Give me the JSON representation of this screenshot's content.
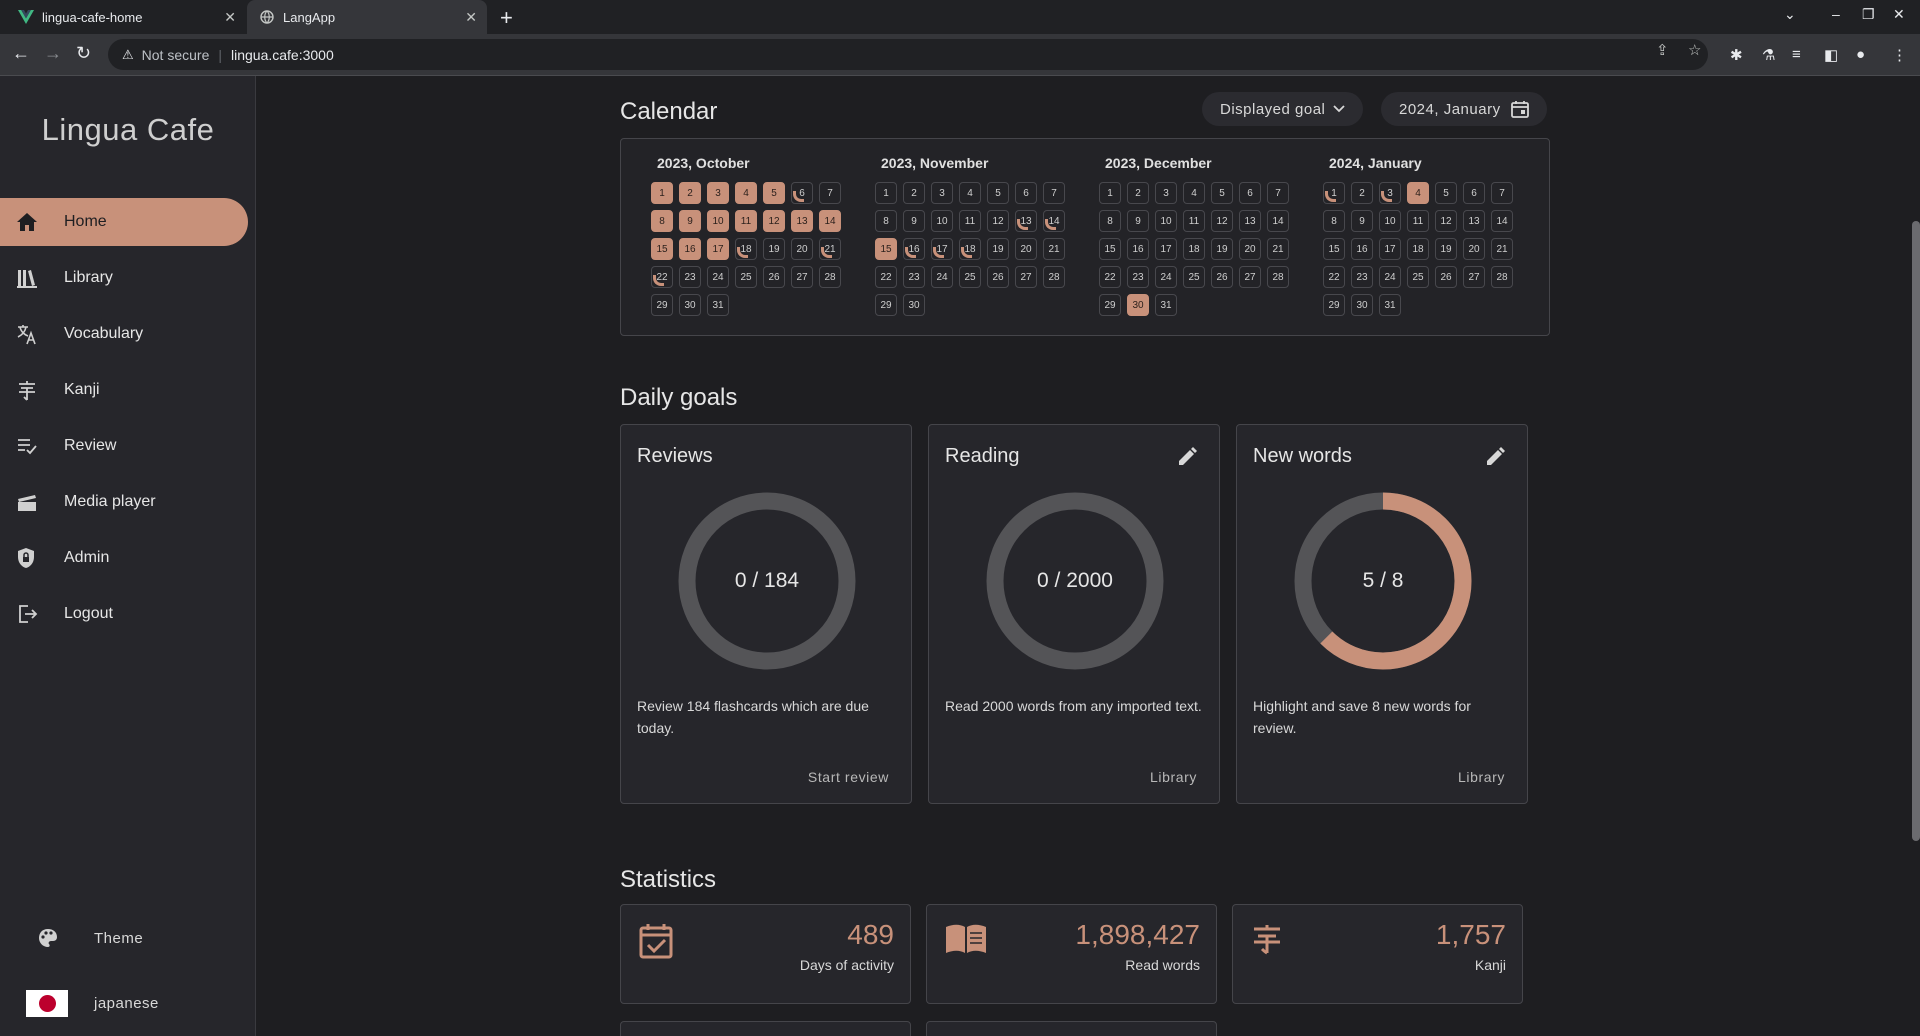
{
  "browser": {
    "tabs": [
      {
        "title": "lingua-cafe-home",
        "active": false
      },
      {
        "title": "LangApp",
        "active": true
      }
    ],
    "security": "Not secure",
    "url": "lingua.cafe:3000"
  },
  "sidebar": {
    "brand": "Lingua Cafe",
    "items": [
      {
        "label": "Home",
        "icon": "home-icon",
        "active": true
      },
      {
        "label": "Library",
        "icon": "library-icon",
        "active": false
      },
      {
        "label": "Vocabulary",
        "icon": "translate-icon",
        "active": false
      },
      {
        "label": "Kanji",
        "icon": "kanji-icon",
        "active": false
      },
      {
        "label": "Review",
        "icon": "review-icon",
        "active": false
      },
      {
        "label": "Media player",
        "icon": "media-icon",
        "active": false
      },
      {
        "label": "Admin",
        "icon": "shield-icon",
        "active": false
      },
      {
        "label": "Logout",
        "icon": "logout-icon",
        "active": false
      }
    ],
    "theme_label": "Theme",
    "language_label": "japanese"
  },
  "calendar": {
    "title": "Calendar",
    "goal_select": "Displayed goal",
    "month_select": "2024, January",
    "months": [
      {
        "title": "2023, October",
        "days": 31,
        "full": [
          1,
          2,
          3,
          4,
          5,
          8,
          9,
          10,
          11,
          12,
          13,
          14,
          15,
          16,
          17
        ],
        "partial": [
          6,
          18,
          21,
          22
        ]
      },
      {
        "title": "2023, November",
        "days": 30,
        "full": [
          15
        ],
        "partial": [
          13,
          14,
          16,
          17,
          18
        ]
      },
      {
        "title": "2023, December",
        "days": 31,
        "full": [
          30
        ],
        "partial": []
      },
      {
        "title": "2024, January",
        "days": 31,
        "full": [
          4
        ],
        "partial": [
          1,
          3
        ]
      }
    ]
  },
  "daily_goals": {
    "title": "Daily goals",
    "cards": [
      {
        "title": "Reviews",
        "progress": "0 / 184",
        "fraction": 0,
        "description": "Review 184 flashcards which are due today.",
        "action": "Start review",
        "editable": false
      },
      {
        "title": "Reading",
        "progress": "0 / 2000",
        "fraction": 0,
        "description": "Read 2000 words from any imported text.",
        "action": "Library",
        "editable": true
      },
      {
        "title": "New words",
        "progress": "5 / 8",
        "fraction": 0.625,
        "description": "Highlight and save 8 new words for review.",
        "action": "Library",
        "editable": true
      }
    ]
  },
  "statistics": {
    "title": "Statistics",
    "cards": [
      {
        "value": "489",
        "label": "Days of activity",
        "icon": "calendar-check-icon"
      },
      {
        "value": "1,898,427",
        "label": "Read words",
        "icon": "book-open-icon"
      },
      {
        "value": "1,757",
        "label": "Kanji",
        "icon": "kanji-icon"
      }
    ]
  },
  "colors": {
    "accent": "#c8917a",
    "ring_track": "#545457",
    "background": "#1e1e21",
    "card": "#26262b"
  }
}
